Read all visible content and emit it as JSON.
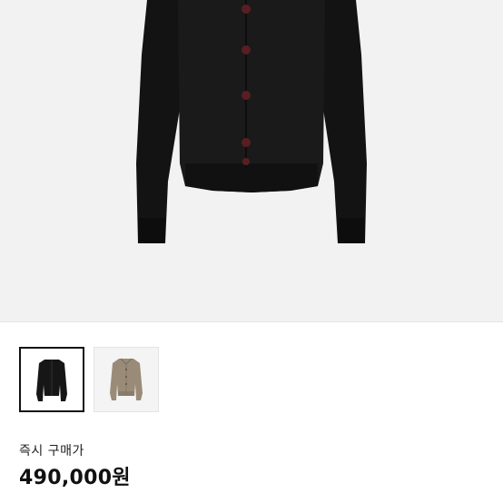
{
  "product": {
    "images": [
      {
        "name": "black-cardigan",
        "selected": true
      },
      {
        "name": "beige-cardigan",
        "selected": false
      }
    ],
    "purchase_label": "즉시 구매가",
    "price": "490,000원"
  }
}
